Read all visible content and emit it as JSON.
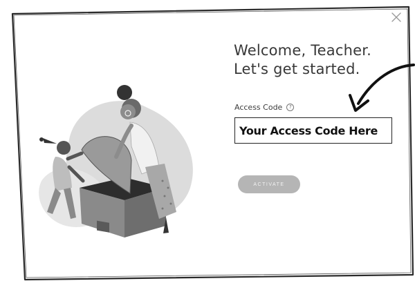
{
  "dialog": {
    "title_line1": "Welcome, Teacher.",
    "title_line2": "Let's get started.",
    "close_symbol": "×"
  },
  "access_code": {
    "label": "Access Code",
    "help_symbol": "?",
    "placeholder": "Your Access Code Here",
    "value": ""
  },
  "activate_button": {
    "label": "ACTIVATE"
  },
  "icons": {
    "close": "close-icon",
    "help": "question-circle-icon",
    "arrow": "curved-arrow-icon"
  },
  "colors": {
    "frame_border": "#2a2a2a",
    "button_bg": "#b5b5b5",
    "text": "#383838"
  }
}
